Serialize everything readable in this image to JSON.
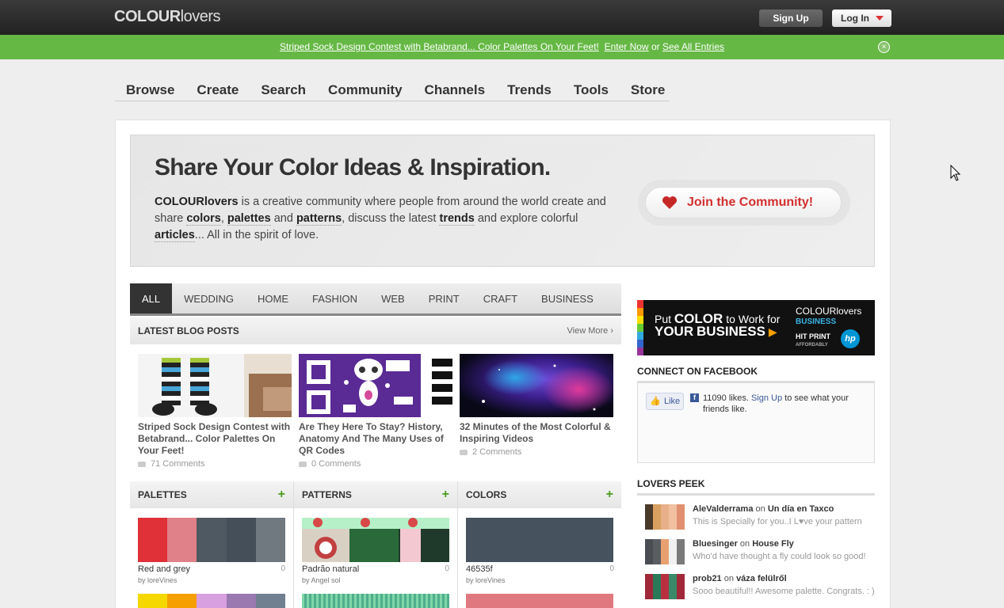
{
  "header": {
    "logo_bold": "COLOUR",
    "logo_light": "lovers",
    "signup": "Sign Up",
    "login": "Log In"
  },
  "promo": {
    "text": "Striped Sock Design Contest with Betabrand... Color Palettes On Your Feet!",
    "enter": "Enter Now",
    "or": "or",
    "see_all": "See All Entries"
  },
  "nav": [
    "Browse",
    "Create",
    "Search",
    "Community",
    "Channels",
    "Trends",
    "Tools",
    "Store"
  ],
  "hero": {
    "title": "Share Your Color Ideas & Inspiration.",
    "brand": "COLOURlovers",
    "t1": " is a creative community where people from around the world create and share ",
    "colors": "colors",
    "c1": ", ",
    "palettes": "palettes",
    "c2": " and ",
    "patterns": "patterns",
    "t2": ", discuss the latest ",
    "trends": "trends",
    "t3": " and explore colorful ",
    "articles": "articles",
    "t4": "... All in the spirit of love.",
    "join": "Join the Community!"
  },
  "categories": [
    "ALL",
    "WEDDING",
    "HOME",
    "FASHION",
    "WEB",
    "PRINT",
    "CRAFT",
    "BUSINESS"
  ],
  "blog": {
    "heading": "LATEST BLOG POSTS",
    "view_more": "View More ›",
    "posts": [
      {
        "title": "Striped Sock Design Contest with Betabrand... Color Palettes On Your Feet!",
        "comments": "71 Comments"
      },
      {
        "title": "Are They Here To Stay? History, Anatomy And The Many Uses of QR Codes",
        "comments": "0 Comments"
      },
      {
        "title": "32 Minutes of the Most Colorful & Inspiring Videos",
        "comments": "2 Comments"
      }
    ]
  },
  "columns": {
    "palettes": {
      "heading": "PALETTES",
      "name": "Red and grey",
      "by": "by loreVines",
      "count": "0",
      "colors": [
        "#e03038",
        "#e08088",
        "#4f5961",
        "#454f59",
        "#707880"
      ]
    },
    "patterns": {
      "heading": "PATTERNS",
      "name": "Padrão natural",
      "by": "by Angel sol",
      "count": "0"
    },
    "colors": {
      "heading": "COLORS",
      "name": "46535f",
      "by": "by loreVines",
      "count": "0",
      "hex": "#46535f"
    }
  },
  "sidebar": {
    "ad": {
      "put": "Put",
      "color": "COLOR",
      "to_work": "to Work for",
      "your": "YOUR",
      "business": "BUSINESS",
      "cl": "COLOURlovers",
      "biz": "BUSINESS",
      "hit": "HIT PRINT",
      "afford": "AFFORDABLY",
      "hp": "hp"
    },
    "facebook": {
      "heading": "CONNECT ON FACEBOOK",
      "like": "Like",
      "likes": "11090 likes.",
      "signup": "Sign Up",
      "rest": "to see what your friends like."
    },
    "peek": {
      "heading": "LOVERS PEEK",
      "items": [
        {
          "user": "AleValderrama",
          "on": "on",
          "target": "Un día en Taxco",
          "msg": "This is Specially for you..I L♥ve your pattern"
        },
        {
          "user": "Bluesinger",
          "on": "on",
          "target": "House Fly",
          "msg": "Who'd have thought a fly could look so good!"
        },
        {
          "user": "prob21",
          "on": "on",
          "target": "váza felülről",
          "msg": "Sooo beautiful!! Awesome palette. Congrats. : )"
        }
      ]
    }
  }
}
